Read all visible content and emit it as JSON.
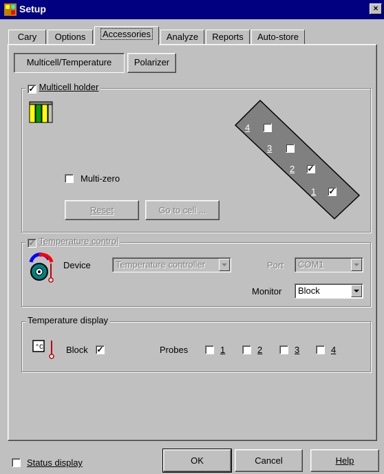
{
  "window": {
    "title": "Setup",
    "close": "×"
  },
  "tabs": [
    "Cary",
    "Options",
    "Accessories",
    "Analyze",
    "Reports",
    "Auto-store"
  ],
  "subtabs": {
    "multicell": "Multicell/Temperature",
    "polarizer": "Polarizer"
  },
  "multicell": {
    "legend": "Multicell holder",
    "checked": true,
    "multizero_label": "Multi-zero",
    "reset_label": "Reset",
    "goto_label": "Go to cell ...",
    "cells": [
      {
        "num": "4",
        "checked": false
      },
      {
        "num": "3",
        "checked": false
      },
      {
        "num": "2",
        "checked": true
      },
      {
        "num": "1",
        "checked": true
      }
    ]
  },
  "temp_control": {
    "legend": "Temperature control",
    "device_label": "Device",
    "device_value": "Temperature controller",
    "port_label": "Port",
    "port_value": "COM1",
    "monitor_label": "Monitor",
    "monitor_value": "Block"
  },
  "temp_display": {
    "legend": "Temperature display",
    "block_label": "Block",
    "probes_label": "Probes",
    "probes": [
      "1",
      "2",
      "3",
      "4"
    ]
  },
  "footer": {
    "status_display": "Status display",
    "ok": "OK",
    "cancel": "Cancel",
    "help": "Help"
  },
  "colors": {
    "titlebar": "#000080",
    "diagram": "#808080",
    "face": "#c0c0c0"
  }
}
